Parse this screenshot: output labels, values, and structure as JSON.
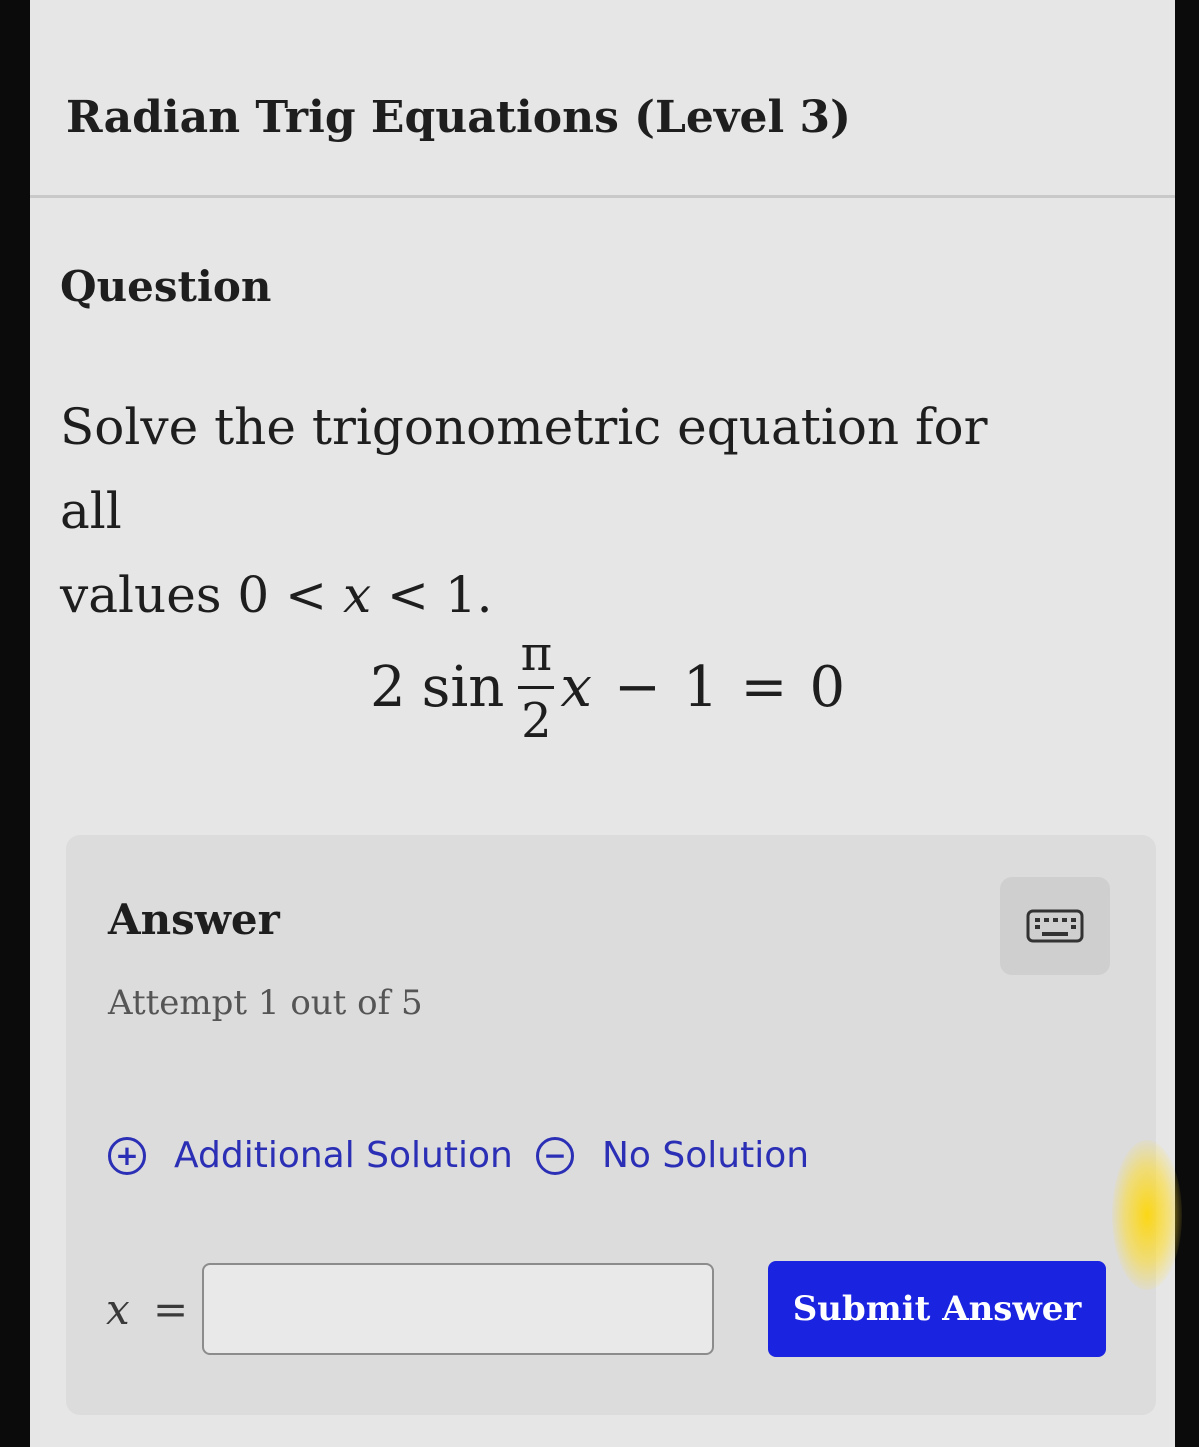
{
  "header": {
    "title": "Radian Trig Equations (Level 3)"
  },
  "question": {
    "heading": "Question",
    "prompt_line1": "Solve the trigonometric equation for all",
    "prompt_line2_prefix": "values ",
    "constraint_left": "0",
    "constraint_lt1": "<",
    "constraint_var": "x",
    "constraint_lt2": "<",
    "constraint_right": "1.",
    "equation": {
      "coef": "2",
      "func": "sin",
      "numerator": "π",
      "denominator": "2",
      "var": "x",
      "minus": "−",
      "const": "1",
      "equals": "=",
      "rhs": "0"
    }
  },
  "answer": {
    "heading": "Answer",
    "attempt": "Attempt 1 out of 5",
    "keyboard_icon": "keyboard-icon",
    "additional_solution_label": "Additional Solution",
    "no_solution_label": "No Solution",
    "input_var": "x",
    "input_equals": "=",
    "input_value": "",
    "input_placeholder": "",
    "submit_label": "Submit Answer"
  },
  "colors": {
    "accent": "#1a23e0",
    "link": "#2b2fb5",
    "panel": "#dcdcdc",
    "background": "#e6e6e6"
  }
}
